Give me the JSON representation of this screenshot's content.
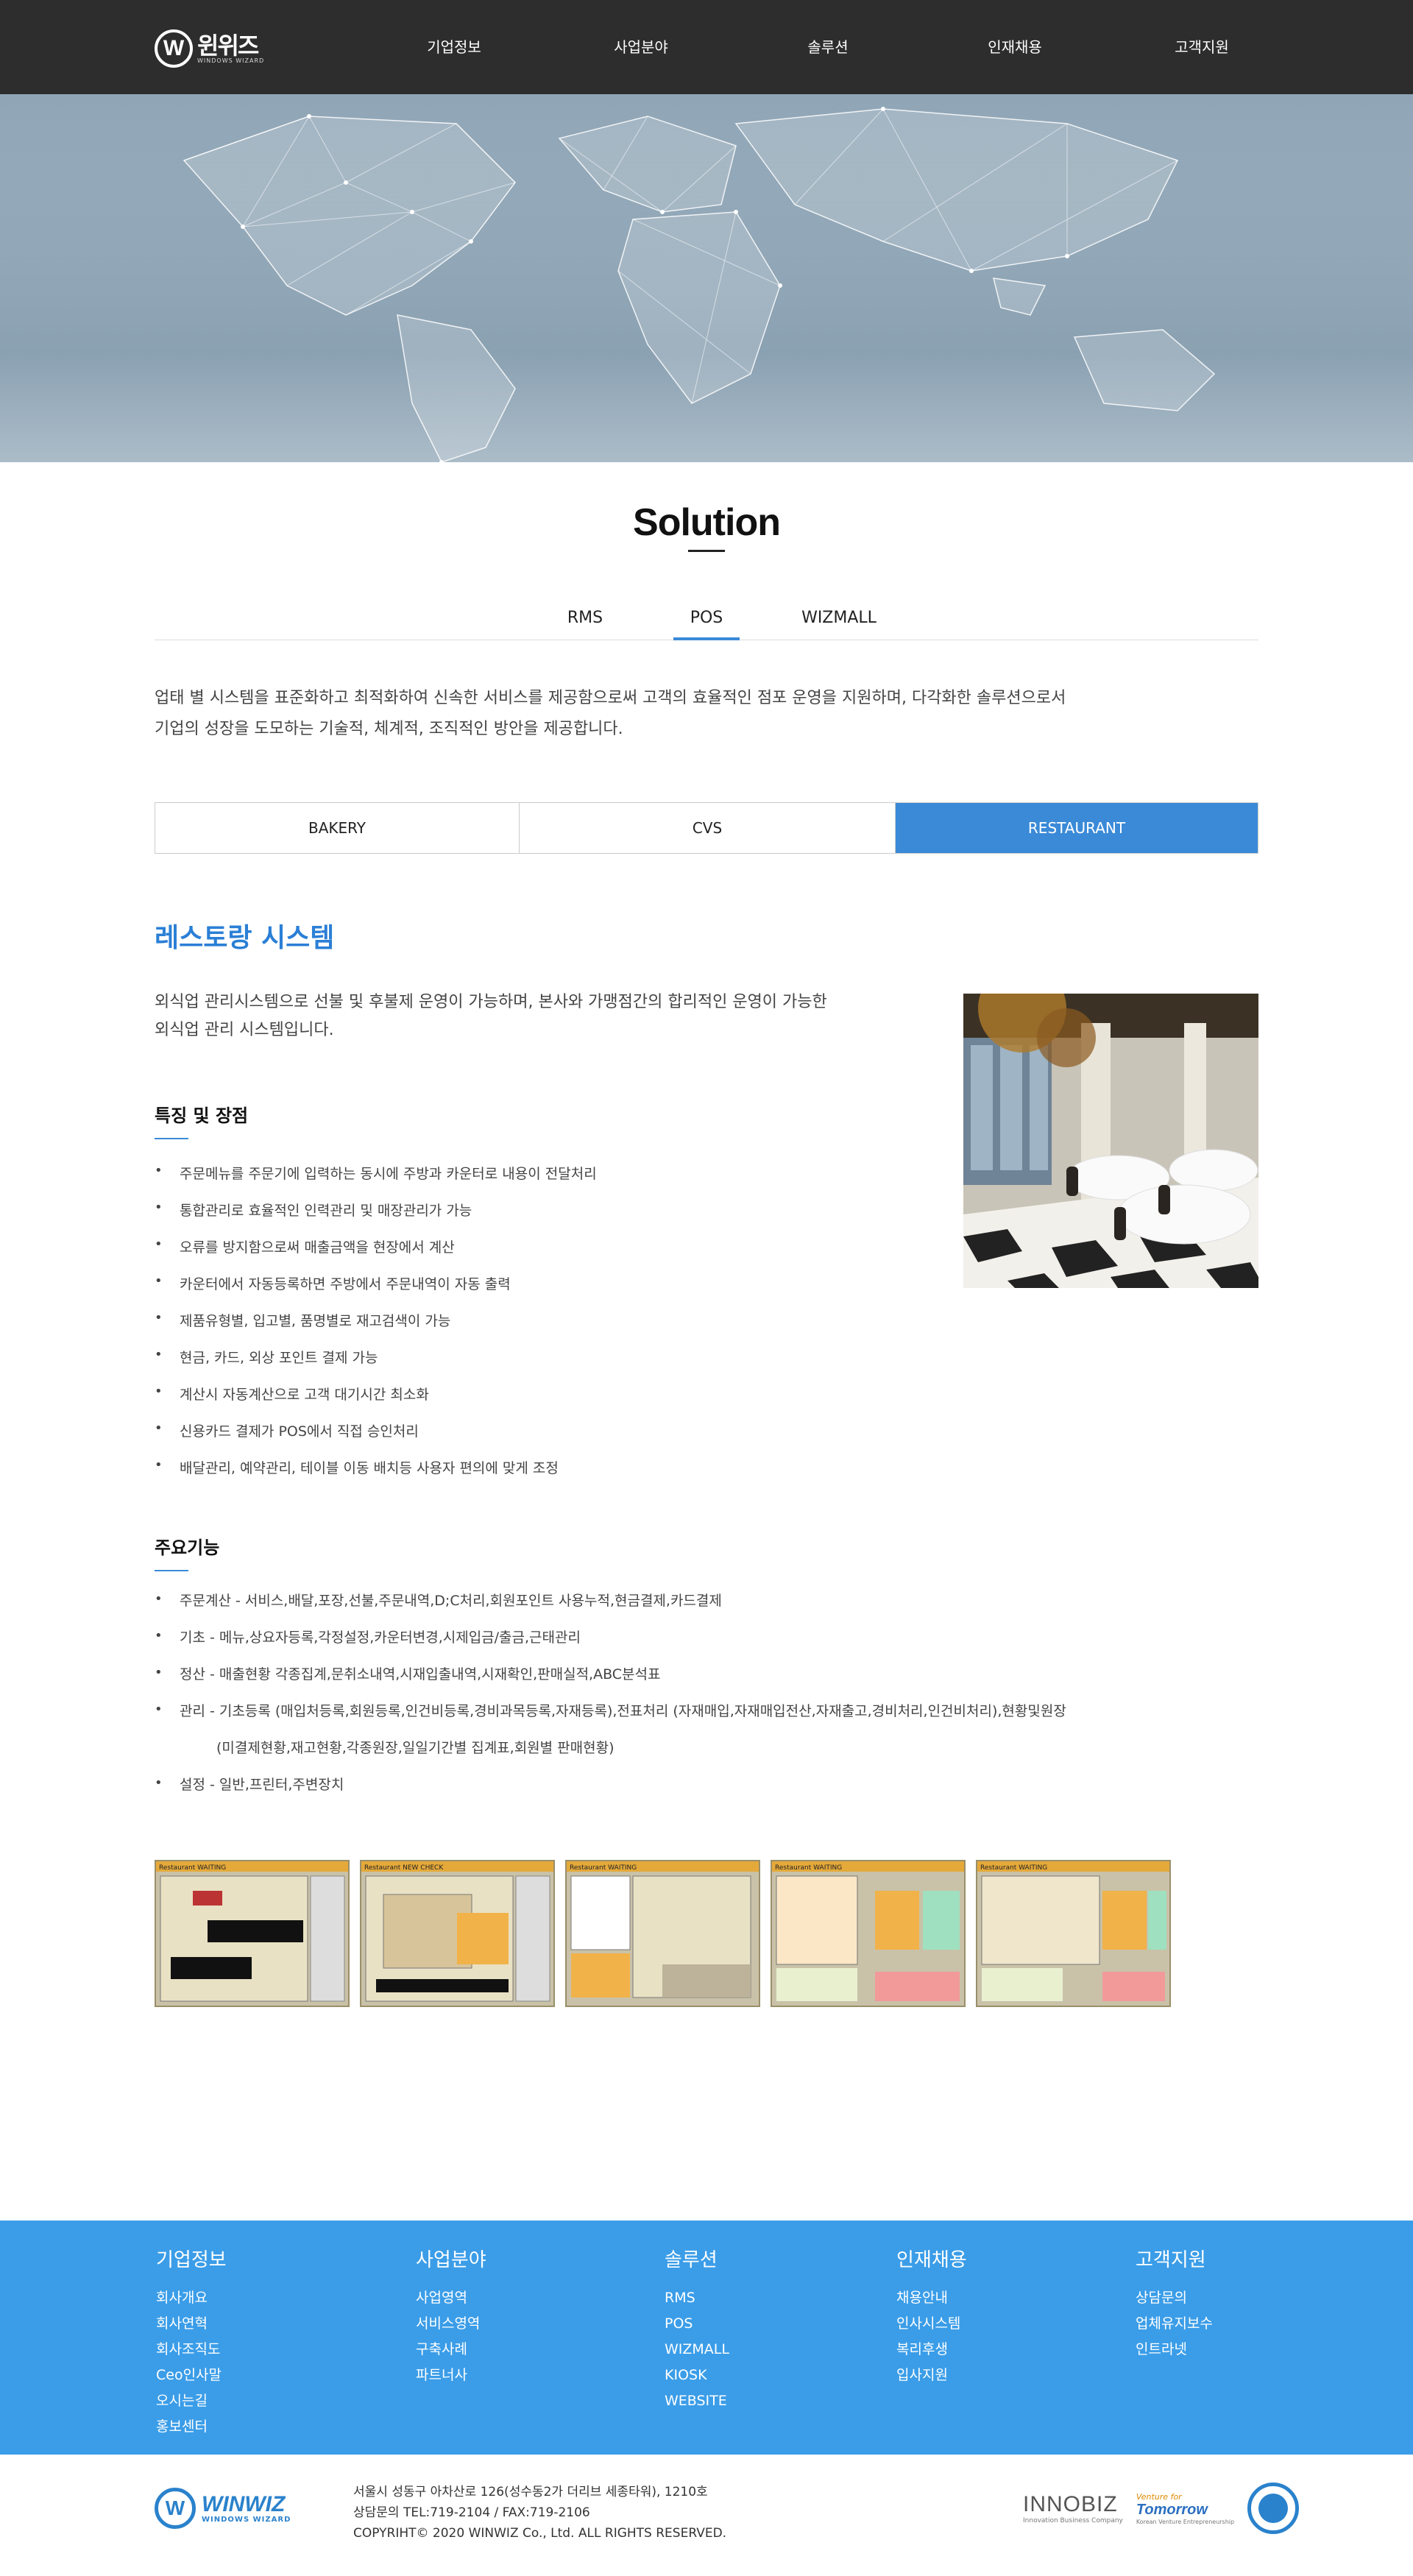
{
  "header": {
    "logo_mark": "W",
    "logo_kr": "윈위즈",
    "logo_en": "WINDOWS WIZARD",
    "nav": [
      "기업정보",
      "사업분야",
      "솔루션",
      "인재채용",
      "고객지원"
    ]
  },
  "page": {
    "title": "Solution",
    "tabs": [
      "RMS",
      "POS",
      "WIZMALL"
    ],
    "active_tab": "POS",
    "intro_line1": "업태 별 시스템을 표준화하고 최적화하여 신속한 서비스를 제공함으로써 고객의 효율적인 점포 운영을 지원하며, 다각화한 솔루션으로서",
    "intro_line2": "기업의 성장을 도모하는 기술적, 체계적, 조직적인 방안을 제공합니다.",
    "subtabs": [
      "BAKERY",
      "CVS",
      "RESTAURANT"
    ],
    "active_subtab": "RESTAURANT"
  },
  "restaurant": {
    "title": "레스토랑 시스템",
    "desc_line1": "외식업 관리시스템으로 선불 및 후불제 운영이 가능하며, 본사와 가맹점간의 합리적인 운영이 가능한",
    "desc_line2": "외식업 관리 시스템입니다.",
    "features_title": "특징 및 장점",
    "features": [
      "주문메뉴를 주문기에 입력하는 동시에 주방과 카운터로 내용이 전달처리",
      "통합관리로 효율적인 인력관리 및 매장관리가 가능",
      "오류를 방지함으로써 매출금액을 현장에서 계산",
      "카운터에서 자동등록하면 주방에서 주문내역이 자동 출력",
      "제품유형별, 입고별, 품명별로 재고검색이 가능",
      "현금, 카드, 외상 포인트 결제 가능",
      "계산시 자동계산으로 고객 대기시간 최소화",
      "신용카드 결제가 POS에서 직접 승인처리",
      "배달관리, 예약관리, 테이블 이동 배치등 사용자 편의에 맞게 조정"
    ],
    "functions_title": "주요기능",
    "functions": [
      "주문계산 - 서비스,배달,포장,선불,주문내역,D;C처리,회원포인트 사용누적,현금결제,카드결제",
      "기초 - 메뉴,상요자등록,각정설정,카운터변경,시제입금/출금,근태관리",
      "정산 - 매출현황 각종집계,문취소내역,시재입출내역,시재확인,판매실적,ABC분석표",
      "관리 - 기초등록 (매입처등록,회원등록,인건비등록,경비과목등록,자재등록),전표처리 (자재매입,자재매입전산,자재출고,경비처리,인건비처리),현황및원장"
    ],
    "functions_cont": "(미결제현황,재고현황,각종원장,일일기간별 집계표,회원별 판매현황)",
    "functions_last": "설정 - 일반,프린터,주변장치",
    "screenshot_tags": [
      "Restaurant WAITING",
      "Restaurant NEW CHECK",
      "Restaurant WAITING",
      "Restaurant WAITING",
      "Restaurant WAITING"
    ]
  },
  "footer": {
    "columns": [
      {
        "title": "기업정보",
        "links": [
          "회사개요",
          "회사연혁",
          "회사조직도",
          "Ceo인사말",
          "오시는길",
          "홍보센터"
        ]
      },
      {
        "title": "사업분야",
        "links": [
          "사업영역",
          "서비스영역",
          "구축사례",
          "파트너사"
        ]
      },
      {
        "title": "솔루션",
        "links": [
          "RMS",
          "POS",
          "WIZMALL",
          "KIOSK",
          "WEBSITE"
        ]
      },
      {
        "title": "인재채용",
        "links": [
          "채용안내",
          "인사시스템",
          "복리후생",
          "입사지원"
        ]
      },
      {
        "title": "고객지원",
        "links": [
          "상담문의",
          "업체유지보수",
          "인트라넷"
        ]
      }
    ],
    "logo_mark": "W",
    "logo_big": "WINWIZ",
    "logo_small": "WINDOWS WIZARD",
    "address": "서울시 성동구 아차산로 126(성수동2가 더리브 세종타워), 1210호",
    "phone": "상담문의 TEL:719-2104 / FAX:719-2106",
    "copyright": "COPYRIHT© 2020 WINWIZ Co., Ltd. ALL RIGHTS RESERVED.",
    "innobiz": "INNOBIZ",
    "innobiz_sub": "Innovation Business Company",
    "venture_a": "Venture for",
    "venture_b": "Tomorrow",
    "venture_c": "Korean Venture Entrepreneurship"
  },
  "colors": {
    "header_bg": "#2d2d2d",
    "accent": "#3a8ad8",
    "footer_bg": "#3b9de8"
  }
}
